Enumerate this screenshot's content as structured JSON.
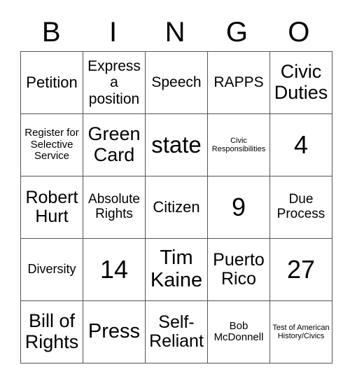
{
  "header": {
    "letters": [
      "B",
      "I",
      "N",
      "G",
      "O"
    ]
  },
  "rows": [
    [
      "Petition",
      "Express a position",
      "Speech",
      "RAPPS",
      "Civic Duties"
    ],
    [
      "Register for Selective Service",
      "Green Card",
      "state",
      "Civic Responsibilities",
      "4"
    ],
    [
      "Robert Hurt",
      "Absolute Rights",
      "Citizen",
      "9",
      "Due Process"
    ],
    [
      "Diversity",
      "14",
      "Tim Kaine",
      "Puerto Rico",
      "27"
    ],
    [
      "Bill of Rights",
      "Press",
      "Self-Reliant",
      "Bob McDonnell",
      "Test of American History/Civics"
    ]
  ]
}
